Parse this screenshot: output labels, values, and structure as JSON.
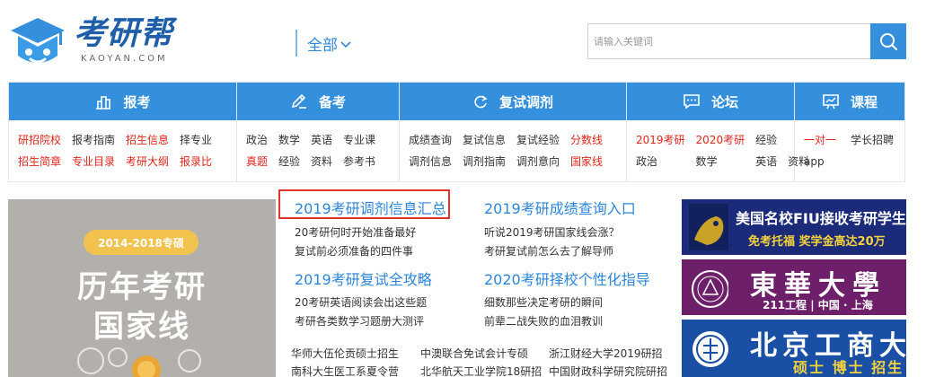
{
  "brand": {
    "name": "考研帮",
    "sub": "KAOYAN.COM",
    "color": "#1f5ea8",
    "accent": "#3490dc"
  },
  "search": {
    "scope": "全部",
    "placeholder": "请输入关键词",
    "button_icon": "search-icon"
  },
  "nav": [
    {
      "title": "报考",
      "icon": "building-icon",
      "links": [
        {
          "text": "研招院校",
          "red": true
        },
        {
          "text": "报考指南",
          "red": false
        },
        {
          "text": "招生信息",
          "red": true
        },
        {
          "text": "择专业",
          "red": false
        },
        {
          "text": "招生简章",
          "red": true
        },
        {
          "text": "专业目录",
          "red": true
        },
        {
          "text": "考研大纲",
          "red": true
        },
        {
          "text": "报录比",
          "red": true
        }
      ]
    },
    {
      "title": "备考",
      "icon": "pencil-icon",
      "links": [
        {
          "text": "政治",
          "red": false
        },
        {
          "text": "数学",
          "red": false
        },
        {
          "text": "英语",
          "red": false
        },
        {
          "text": "专业课",
          "red": false
        },
        {
          "text": "真题",
          "red": true
        },
        {
          "text": "经验",
          "red": false
        },
        {
          "text": "资料",
          "red": false
        },
        {
          "text": "参考书",
          "red": false
        }
      ]
    },
    {
      "title": "复试调剂",
      "icon": "refresh-icon",
      "links": [
        {
          "text": "成绩查询",
          "red": false
        },
        {
          "text": "复试信息",
          "red": false
        },
        {
          "text": "复试经验",
          "red": false
        },
        {
          "text": "分数线",
          "red": true
        },
        {
          "text": "调剂信息",
          "red": false
        },
        {
          "text": "调剂指南",
          "red": false
        },
        {
          "text": "调剂意向",
          "red": false
        },
        {
          "text": "国家线",
          "red": true
        }
      ]
    },
    {
      "title": "论坛",
      "icon": "chat-icon",
      "links": [
        {
          "text": "2019考研",
          "red": true
        },
        {
          "text": "2020考研",
          "red": true
        },
        {
          "text": "经验",
          "red": false
        },
        {
          "text": "政治",
          "red": false
        },
        {
          "text": "数学",
          "red": false
        },
        {
          "text": "英语",
          "red": false
        },
        {
          "text": "资料",
          "red": false
        }
      ]
    },
    {
      "title": "课程",
      "icon": "chart-board-icon",
      "links": [
        {
          "text": "一对一",
          "red": true
        },
        {
          "text": "学长招聘",
          "red": false
        },
        {
          "text": "app",
          "red": false
        }
      ]
    }
  ],
  "banner": {
    "pill": "2014-2018专硕",
    "title_line1": "历年考研",
    "title_line2": "国家线"
  },
  "news": {
    "left": [
      {
        "head": "2019考研调剂信息汇总",
        "items": [
          "20考研何时开始准备最好",
          "复试前必须准备的四件事"
        ]
      },
      {
        "head": "2019考研复试全攻略",
        "items": [
          "20考研英语阅读会出这些题",
          "考研各类数学习题册大测评"
        ]
      }
    ],
    "right": [
      {
        "head": "2019考研成绩查询入口",
        "items": [
          "听说2019考研国家线会涨？",
          "考研复试前怎么去了解导师"
        ]
      },
      {
        "head": "2020考研择校个性化指导",
        "items": [
          "细数那些决定考研的瞬间",
          "前辈二战失败的血泪教训"
        ]
      }
    ],
    "bottom": [
      [
        "华师大伍伦贡硕士招生",
        "中澳联合免试会计专硕",
        "浙江财经大学2019研招"
      ],
      [
        "南科大生医工系夏令营",
        "北华航天工业学院18研招",
        "中国财政科学研究院研招"
      ]
    ]
  },
  "ads": {
    "ad1": {
      "line1": "美国名校FIU接收考研学生",
      "line2": "免考托福  奖学金高达20万",
      "emblem": "FIU"
    },
    "ad2": {
      "line1": "東華大學",
      "line2": "211工程 | 中国 · 上海"
    },
    "ad3": {
      "line1": "北京工商大學",
      "line2": "硕士  博士  招生"
    }
  }
}
